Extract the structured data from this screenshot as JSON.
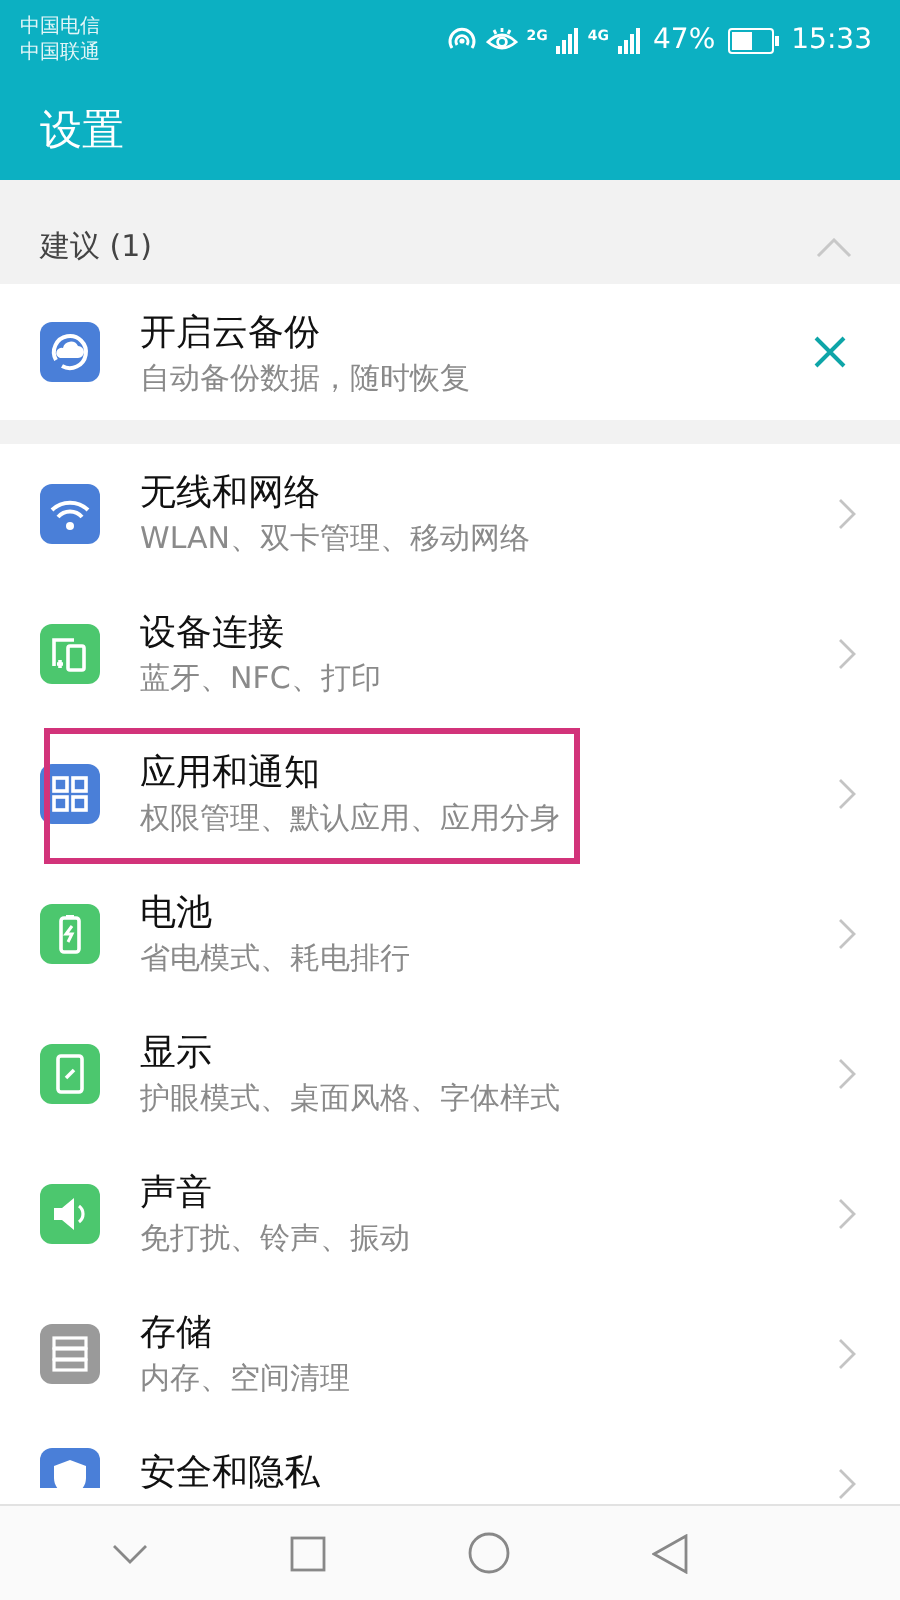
{
  "status_bar": {
    "carriers": [
      "中国电信",
      "中国联通"
    ],
    "networks": [
      "2G",
      "4G"
    ],
    "battery": "47%",
    "time": "15:33"
  },
  "app_bar": {
    "title": "设置"
  },
  "suggestions": {
    "header": "建议 (1)",
    "expanded": true,
    "items": [
      {
        "title": "开启云备份",
        "subtitle": "自动备份数据，随时恢复"
      }
    ]
  },
  "settings": [
    {
      "title": "无线和网络",
      "subtitle": "WLAN、双卡管理、移动网络",
      "highlighted": false
    },
    {
      "title": "设备连接",
      "subtitle": "蓝牙、NFC、打印",
      "highlighted": false
    },
    {
      "title": "应用和通知",
      "subtitle": "权限管理、默认应用、应用分身",
      "highlighted": true
    },
    {
      "title": "电池",
      "subtitle": "省电模式、耗电排行",
      "highlighted": false
    },
    {
      "title": "显示",
      "subtitle": "护眼模式、桌面风格、字体样式",
      "highlighted": false
    },
    {
      "title": "声音",
      "subtitle": "免打扰、铃声、振动",
      "highlighted": false
    },
    {
      "title": "存储",
      "subtitle": "内存、空间清理",
      "highlighted": false
    },
    {
      "title": "安全和隐私",
      "highlighted": false
    }
  ]
}
